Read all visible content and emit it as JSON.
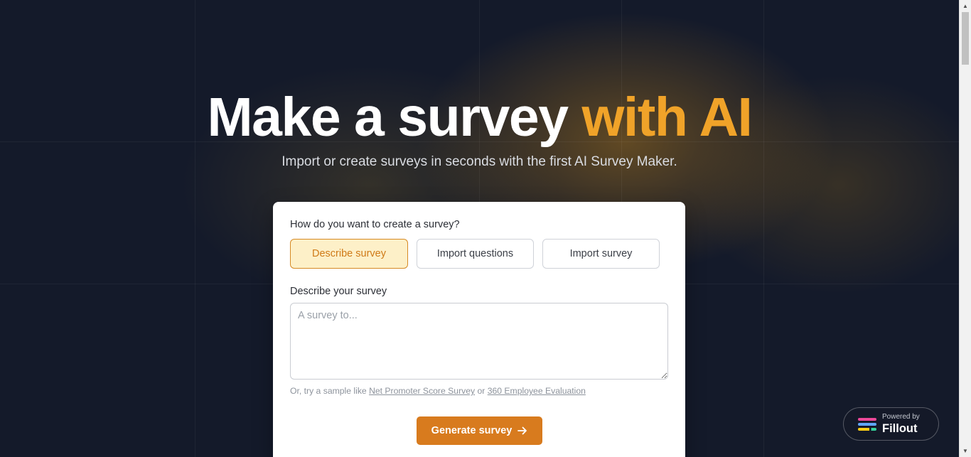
{
  "hero": {
    "title_main": "Make a survey ",
    "title_accent": "with AI",
    "subtitle": "Import or create surveys in seconds with the first AI Survey Maker."
  },
  "form": {
    "question": "How do you want to create a survey?",
    "options": [
      {
        "label": "Describe survey",
        "selected": true
      },
      {
        "label": "Import questions",
        "selected": false
      },
      {
        "label": "Import survey",
        "selected": false
      }
    ],
    "describe_label": "Describe your survey",
    "describe_placeholder": "A survey to...",
    "describe_value": "",
    "sample_prefix": "Or, try a sample like ",
    "sample_link_1": "Net Promoter Score Survey",
    "sample_or": " or ",
    "sample_link_2": "360 Employee Evaluation",
    "generate_label": "Generate survey",
    "generate_icon": "arrow-right-icon"
  },
  "badge": {
    "powered_by": "Powered by",
    "brand": "Fillout",
    "logo_icon": "fillout-logo-icon"
  },
  "colors": {
    "accent": "#f0a329",
    "button": "#d87b1e",
    "selected_bg": "#fdf0c8",
    "selected_text": "#cf7a17",
    "background": "#141a2a"
  }
}
